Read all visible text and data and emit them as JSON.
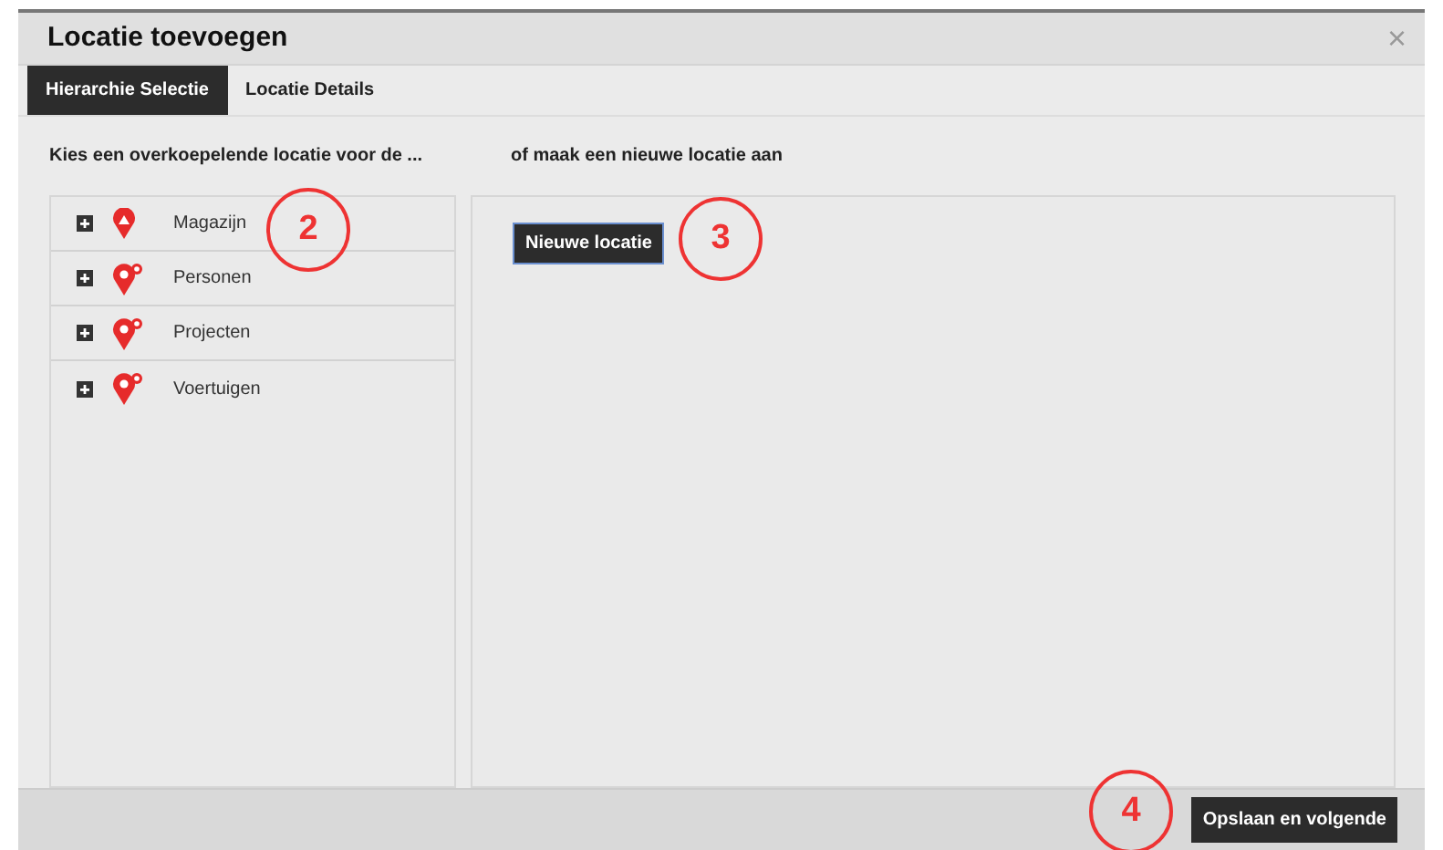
{
  "dialog": {
    "title": "Locatie toevoegen",
    "close": "×"
  },
  "tabs": [
    {
      "label": "Hierarchie Selectie",
      "selected": true
    },
    {
      "label": "Locatie Details",
      "selected": false
    }
  ],
  "left": {
    "instruction": "Kies een overkoepelende locatie voor de ...",
    "tree": [
      {
        "label": "Magazijn",
        "kind": "warehouse",
        "expanded": false
      },
      {
        "label": "Personen",
        "kind": "group",
        "expanded": false
      },
      {
        "label": "Projecten",
        "kind": "group",
        "expanded": false
      },
      {
        "label": "Voertuigen",
        "kind": "group",
        "expanded": false
      }
    ]
  },
  "right": {
    "instruction": "of maak een nieuwe locatie aan",
    "button": "Nieuwe locatie"
  },
  "footer": {
    "button": "Opslaan en volgende"
  },
  "annotations": [
    {
      "label": "2"
    },
    {
      "label": "3"
    },
    {
      "label": "4"
    }
  ]
}
